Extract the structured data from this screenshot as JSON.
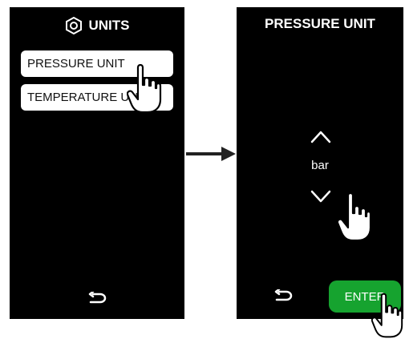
{
  "left_screen": {
    "title": "UNITS",
    "title_icon": "hex-nut-icon",
    "menu_items": [
      {
        "label": "PRESSURE UNIT"
      },
      {
        "label": "TEMPERATURE UNIT"
      }
    ],
    "back_icon": "return-arrow-icon"
  },
  "right_screen": {
    "title": "PRESSURE UNIT",
    "selected_value": "bar",
    "up_icon": "chevron-up-icon",
    "down_icon": "chevron-down-icon",
    "back_icon": "return-arrow-icon",
    "enter_label": "ENTER"
  },
  "colors": {
    "screen_bg": "#000000",
    "enter_bg": "#16a32f",
    "text_light": "#ffffff"
  }
}
